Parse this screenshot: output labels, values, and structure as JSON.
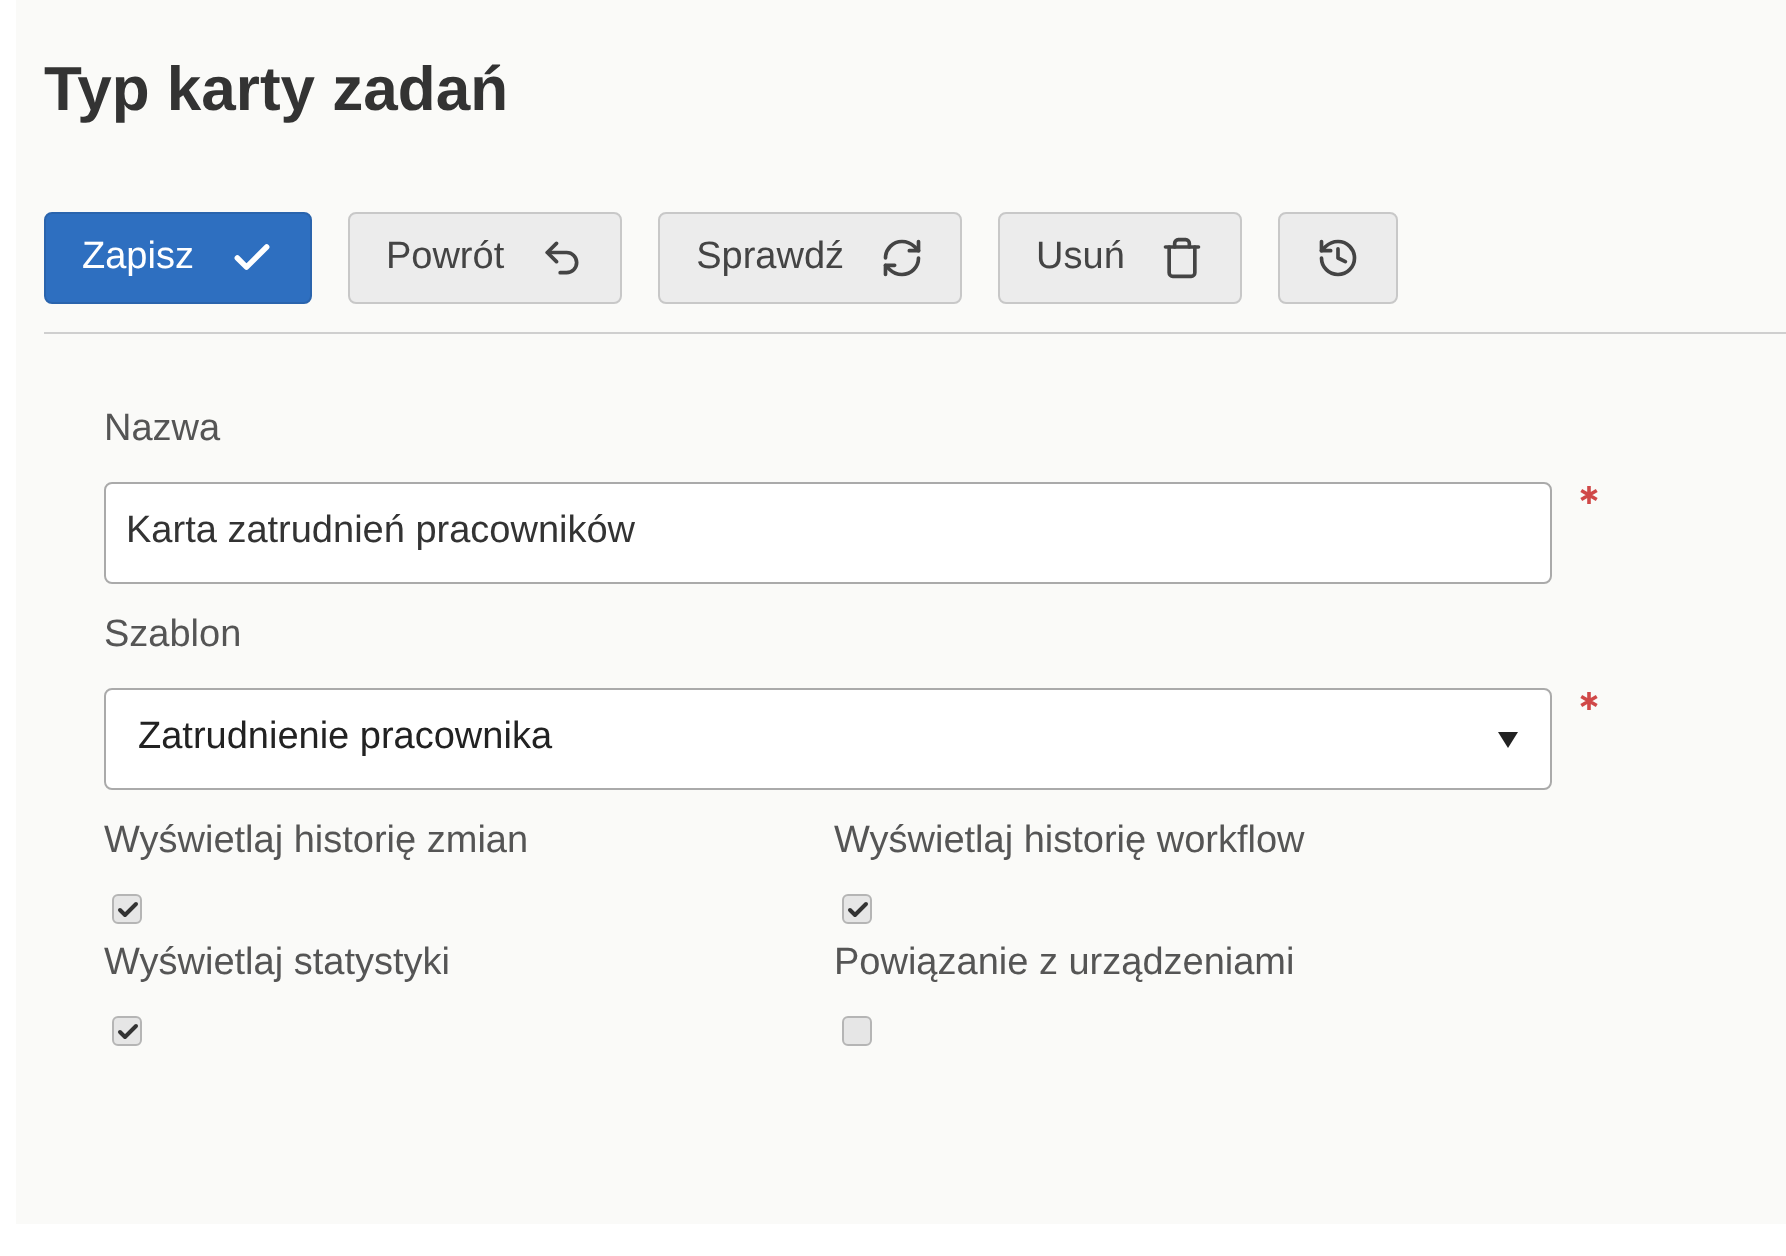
{
  "title": "Typ karty zadań",
  "toolbar": [
    {
      "label": "Zapisz"
    },
    {
      "label": "Powrót"
    },
    {
      "label": "Sprawdź"
    },
    {
      "label": "Usuń"
    }
  ],
  "fields": [
    {
      "kind": "text",
      "label": "Nazwa",
      "value": "Karta zatrudnień pracowników",
      "required": true
    },
    {
      "kind": "select",
      "label": "Szablon",
      "value": "Zatrudnienie pracownika",
      "required": true
    }
  ],
  "checkboxes": [
    {
      "label": "Wyświetlaj historię zmian",
      "checked": true
    },
    {
      "label": "Wyświetlaj historię workflow",
      "checked": true
    },
    {
      "label": "Wyświetlaj statystyki",
      "checked": true
    },
    {
      "label": "Powiązanie z urządzeniami",
      "checked": false
    }
  ]
}
